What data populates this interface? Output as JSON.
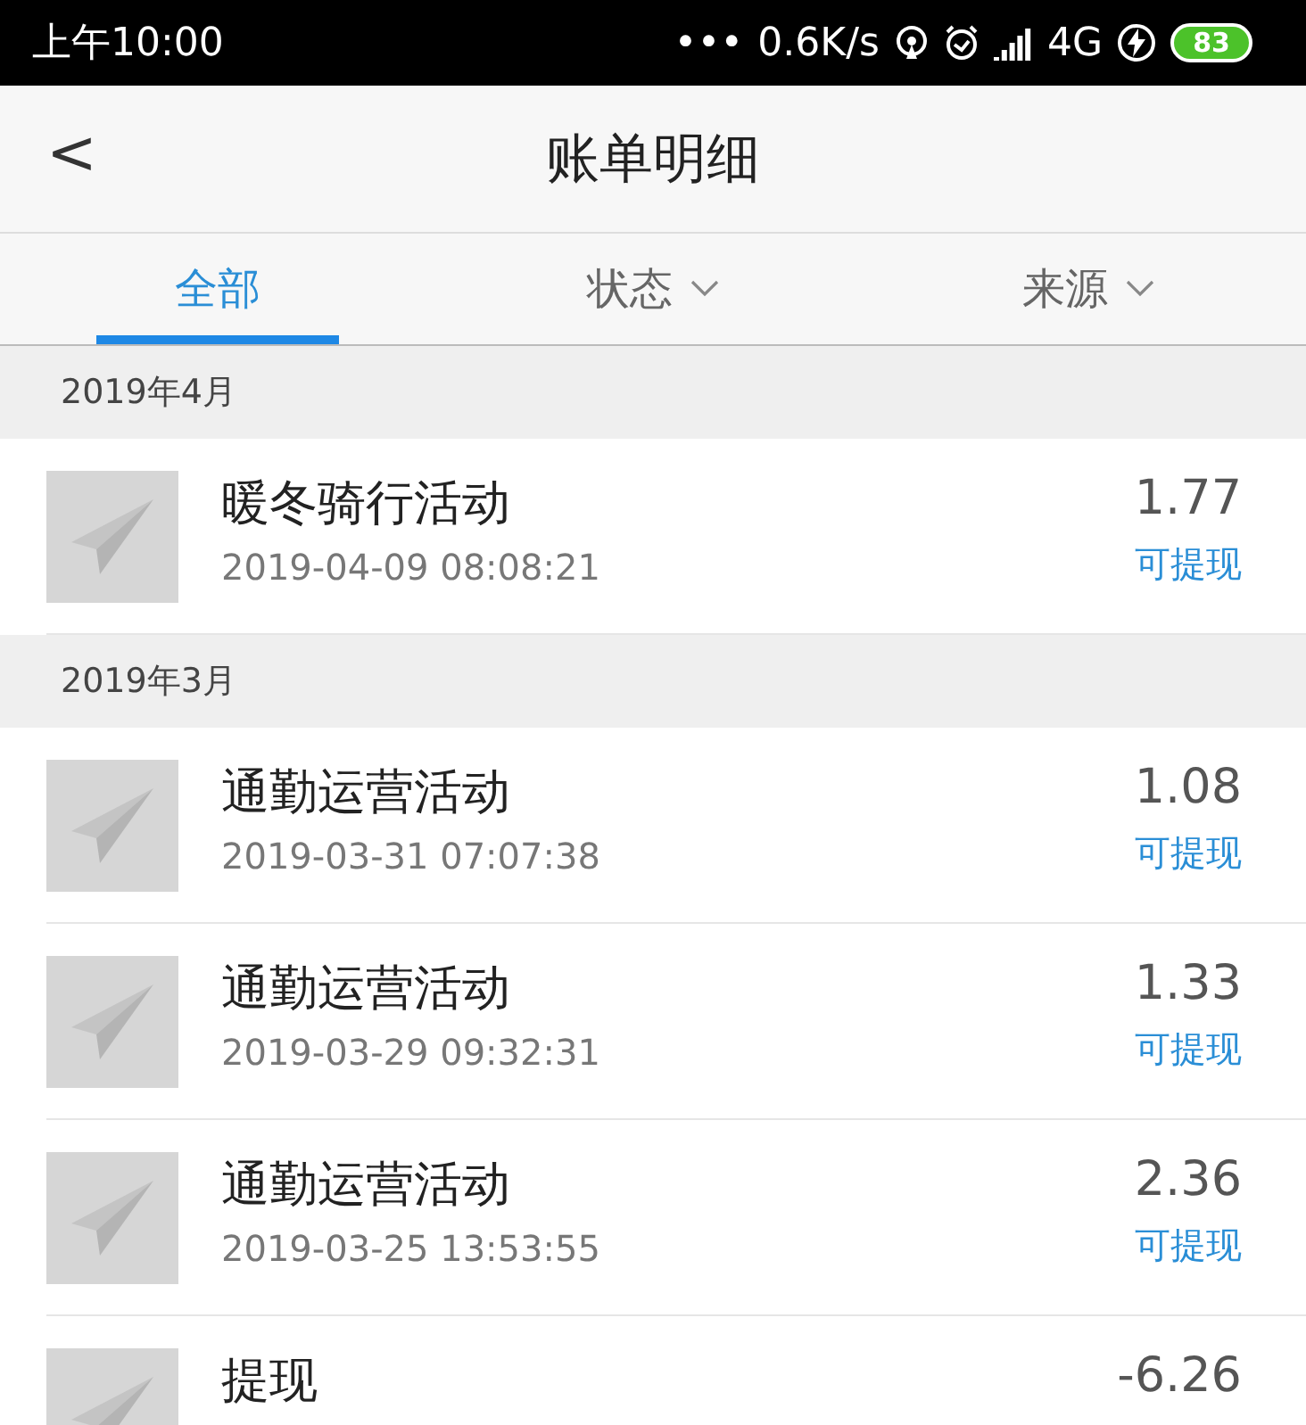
{
  "status_bar": {
    "time": "上午10:00",
    "dots": "•••",
    "speed": "0.6K/s",
    "network": "4G",
    "battery": "83"
  },
  "header": {
    "back": "<",
    "title": "账单明细"
  },
  "tabs": [
    {
      "label": "全部",
      "selected": true,
      "dropdown": false
    },
    {
      "label": "状态",
      "selected": false,
      "dropdown": true
    },
    {
      "label": "来源",
      "selected": false,
      "dropdown": true
    }
  ],
  "sections": [
    {
      "month": "2019年4月",
      "entries": [
        {
          "title": "暖冬骑行活动",
          "time": "2019-04-09 08:08:21",
          "amount": "1.77",
          "status": "可提现"
        }
      ]
    },
    {
      "month": "2019年3月",
      "entries": [
        {
          "title": "通勤运营活动",
          "time": "2019-03-31 07:07:38",
          "amount": "1.08",
          "status": "可提现"
        },
        {
          "title": "通勤运营活动",
          "time": "2019-03-29 09:32:31",
          "amount": "1.33",
          "status": "可提现"
        },
        {
          "title": "通勤运营活动",
          "time": "2019-03-25 13:53:55",
          "amount": "2.36",
          "status": "可提现"
        },
        {
          "title": "提现",
          "amount": "-6.26"
        }
      ]
    }
  ]
}
